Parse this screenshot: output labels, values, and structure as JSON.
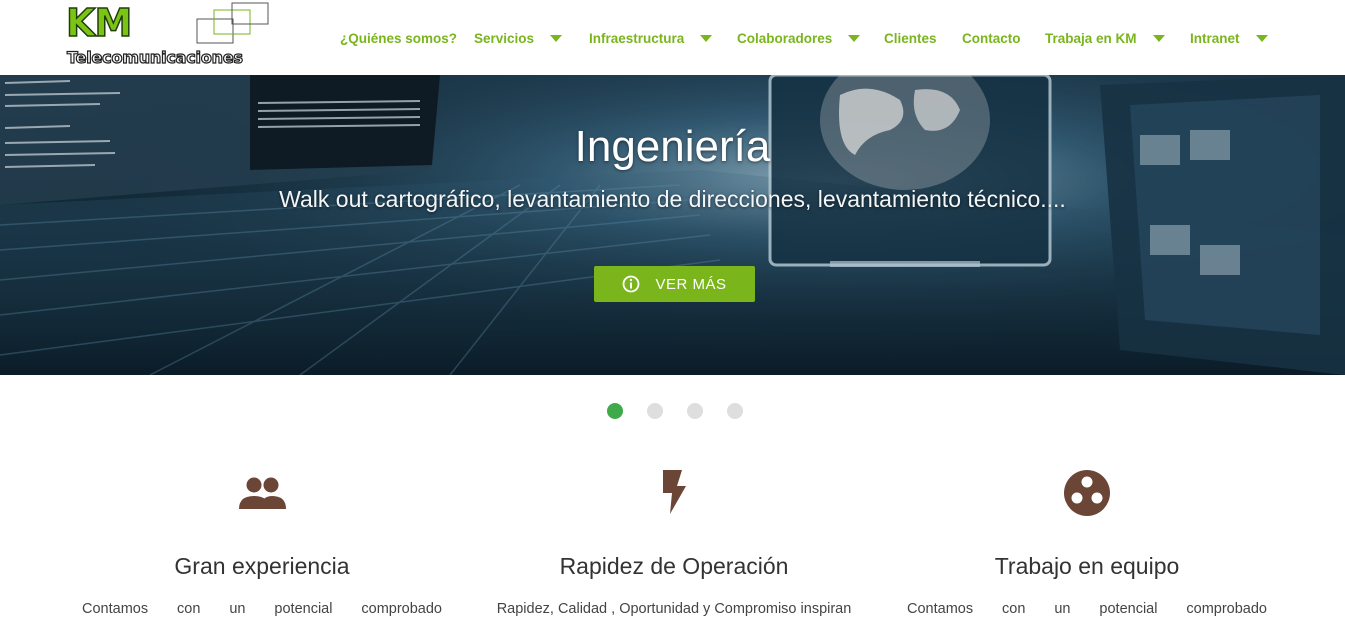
{
  "brand": {
    "logo_main": "KM",
    "logo_sub": "Telecomunicaciones",
    "accent_color": "#7ab51d"
  },
  "nav": {
    "items": [
      {
        "label": "¿Quiénes somos?",
        "has_dropdown": false
      },
      {
        "label": "Servicios",
        "has_dropdown": true
      },
      {
        "label": "Infraestructura",
        "has_dropdown": true
      },
      {
        "label": "Colaboradores",
        "has_dropdown": true
      },
      {
        "label": "Clientes",
        "has_dropdown": false
      },
      {
        "label": "Contacto",
        "has_dropdown": false
      },
      {
        "label": "Trabaja en KM",
        "has_dropdown": true
      },
      {
        "label": "Intranet",
        "has_dropdown": true
      }
    ]
  },
  "hero": {
    "title": "Ingeniería",
    "subtitle": "Walk out cartográfico, levantamiento de direcciones, levantamiento técnico....",
    "button_label": "VER MÁS",
    "button_icon": "info-circle-icon"
  },
  "slider": {
    "slide_count": 4,
    "active_index": 0,
    "active_color": "#3faa49"
  },
  "features": [
    {
      "icon": "people-icon",
      "title": "Gran experiencia",
      "text": "Contamos con un potencial comprobado"
    },
    {
      "icon": "lightning-icon",
      "title": "Rapidez de Operación",
      "text": "Rapidez, Calidad , Oportunidad y Compromiso inspiran"
    },
    {
      "icon": "team-circle-icon",
      "title": "Trabajo en equipo",
      "text": "Contamos con un potencial comprobado"
    }
  ],
  "icon_color": "#6b4637"
}
